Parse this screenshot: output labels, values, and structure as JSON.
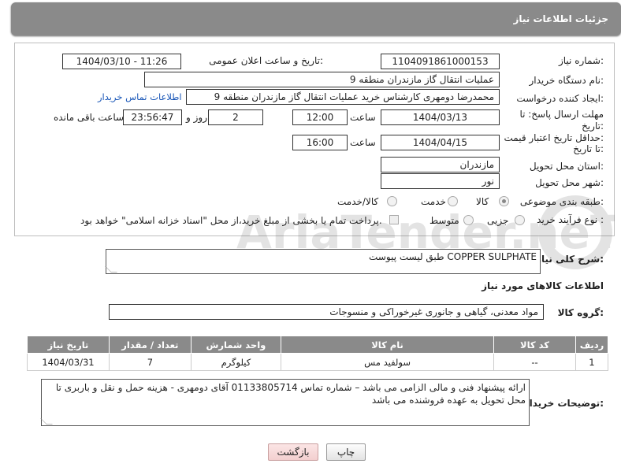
{
  "header": {
    "title": "جزئیات اطلاعات نیاز"
  },
  "need_number": {
    "label": "شماره نیاز:",
    "value": "1104091861000153"
  },
  "announce": {
    "label": "تاریخ و ساعت اعلان عمومی:",
    "value": "1404/03/10 - 11:26"
  },
  "buyer_org": {
    "label": "نام دستگاه خریدار:",
    "value": "عملیات انتقال گاز مازندران منطقه 9"
  },
  "requester": {
    "label": "ایجاد کننده درخواست:",
    "value": "محمدرضا دومهری کارشناس خرید عملیات انتقال گاز مازندران منطقه 9",
    "contact_link": "اطلاعات تماس خریدار"
  },
  "reply_deadline": {
    "label1": "مهلت ارسال پاسخ: تا",
    "label2": "تاریخ:",
    "date": "1404/03/13",
    "time_label": "ساعت",
    "time": "12:00",
    "days": "2",
    "days_label": "روز و",
    "remaining": "23:56:47",
    "remaining_label": "ساعت باقی مانده"
  },
  "price_validity": {
    "label1": "حداقل تاریخ اعتبار قیمت:",
    "label2": "تا تاریخ:",
    "date": "1404/04/15",
    "time_label": "ساعت",
    "time": "16:00"
  },
  "province": {
    "label": "استان محل تحویل:",
    "value": "مازندران"
  },
  "city": {
    "label": "شهر محل تحویل:",
    "value": "نور"
  },
  "category": {
    "label": "طبقه بندی موضوعی:",
    "options": [
      "کالا",
      "خدمت",
      "کالا/خدمت"
    ],
    "selected": "کالا"
  },
  "purchase_type": {
    "label": "نوع فرآیند خرید :",
    "options": [
      "جزیی",
      "متوسط"
    ],
    "payment_note": "پرداخت تمام یا بخشی از مبلغ خرید،از محل \"اسناد خزانه اسلامی\" خواهد بود."
  },
  "need_desc": {
    "label": "شرح کلی نیاز:",
    "value": "COPPER SULPHATE طبق لیست پیوست"
  },
  "goods_info": {
    "title": "اطلاعات کالاهای مورد نیاز"
  },
  "goods_group": {
    "label": "گروه کالا:",
    "value": "مواد معدنی، گیاهی و جانوری غیرخوراکی و منسوجات"
  },
  "table": {
    "headers": [
      "ردیف",
      "کد کالا",
      "نام کالا",
      "واحد شمارش",
      "تعداد / مقدار",
      "تاریخ نیاز"
    ],
    "rows": [
      [
        "1",
        "--",
        "سولفید مس",
        "کیلوگرم",
        "7",
        "1404/03/31"
      ]
    ]
  },
  "buyer_notes": {
    "label": "توضیحات خریدار:",
    "value": "ارائه پیشنهاد فنی  و مالی الزامی می باشد – شماره تماس 01133805714 آقای دومهری  - هزینه حمل و نقل و باربری تا محل تحویل به عهده فروشنده می باشد"
  },
  "buttons": {
    "print": "چاپ",
    "back": "بازگشت"
  },
  "watermark": {
    "text": "AriaTender.neT"
  },
  "colors": {
    "header_bg": "#8a8a8a",
    "link": "#1a57b8"
  }
}
